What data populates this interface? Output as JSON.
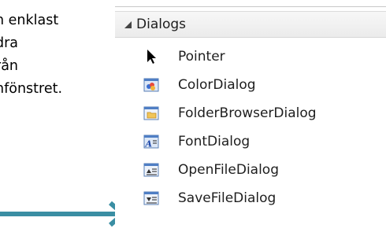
{
  "slide_text": {
    "lines": [
      "n enklast",
      " dra",
      "rån",
      "nfönstret."
    ]
  },
  "toolbox": {
    "group_label": "Dialogs",
    "items": [
      {
        "label": "Pointer",
        "icon": "pointer-icon"
      },
      {
        "label": "ColorDialog",
        "icon": "colordialog-icon"
      },
      {
        "label": "FolderBrowserDialog",
        "icon": "folderbrowserdialog-icon"
      },
      {
        "label": "FontDialog",
        "icon": "fontdialog-icon"
      },
      {
        "label": "OpenFileDialog",
        "icon": "openfiledialog-icon"
      },
      {
        "label": "SaveFileDialog",
        "icon": "savefiledialog-icon"
      }
    ]
  },
  "colors": {
    "arrow": "#3a8ea3",
    "header_bg": "#efefef"
  }
}
